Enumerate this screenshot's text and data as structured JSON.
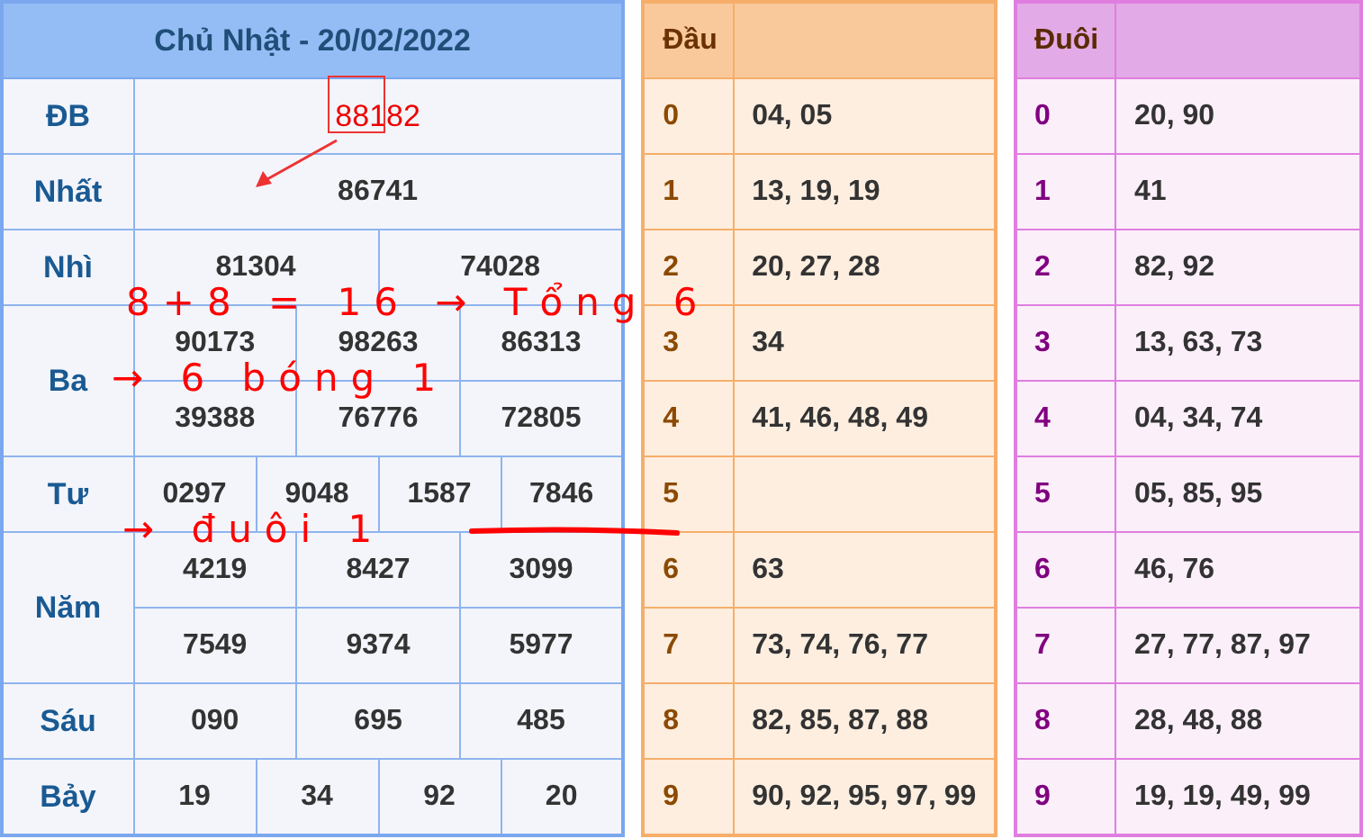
{
  "result_table": {
    "title": "Chủ Nhật - 20/02/2022",
    "prizes": [
      {
        "label": "ĐB",
        "kind": "special",
        "rows": [
          [
            "88182"
          ]
        ]
      },
      {
        "label": "Nhất",
        "kind": "normal",
        "rows": [
          [
            "86741"
          ]
        ]
      },
      {
        "label": "Nhì",
        "kind": "normal",
        "rows": [
          [
            "81304",
            "74028"
          ]
        ]
      },
      {
        "label": "Ba",
        "kind": "normal",
        "rows": [
          [
            "90173",
            "98263",
            "86313"
          ],
          [
            "39388",
            "76776",
            "72805"
          ]
        ]
      },
      {
        "label": "Tư",
        "kind": "normal",
        "rows": [
          [
            "0297",
            "9048",
            "1587",
            "7846"
          ]
        ]
      },
      {
        "label": "Năm",
        "kind": "normal",
        "rows": [
          [
            "4219",
            "8427",
            "3099"
          ],
          [
            "7549",
            "9374",
            "5977"
          ]
        ]
      },
      {
        "label": "Sáu",
        "kind": "normal",
        "rows": [
          [
            "090",
            "695",
            "485"
          ]
        ]
      },
      {
        "label": "Bảy",
        "kind": "normal",
        "rows": [
          [
            "19",
            "34",
            "92",
            "20"
          ]
        ]
      }
    ]
  },
  "head_table": {
    "title": "Đầu",
    "rows": [
      {
        "digit": "0",
        "numbers": "04, 05"
      },
      {
        "digit": "1",
        "numbers": "13, 19, 19"
      },
      {
        "digit": "2",
        "numbers": "20, 27, 28"
      },
      {
        "digit": "3",
        "numbers": "34"
      },
      {
        "digit": "4",
        "numbers": "41, 46, 48, 49"
      },
      {
        "digit": "5"
      },
      {
        "digit": "6",
        "numbers": "63"
      },
      {
        "digit": "7",
        "numbers": "73, 74, 76, 77"
      },
      {
        "digit": "8",
        "numbers": "82, 85, 87, 88"
      },
      {
        "digit": "9",
        "numbers": "90, 92, 95, 97, 99"
      }
    ]
  },
  "tail_table": {
    "title": "Đuôi",
    "rows": [
      {
        "digit": "0",
        "numbers": "20, 90"
      },
      {
        "digit": "1",
        "numbers": "41"
      },
      {
        "digit": "2",
        "numbers": "82, 92"
      },
      {
        "digit": "3",
        "numbers": "13, 63, 73"
      },
      {
        "digit": "4",
        "numbers": "04, 34, 74"
      },
      {
        "digit": "5",
        "numbers": "05, 85, 95"
      },
      {
        "digit": "6",
        "numbers": "46, 76"
      },
      {
        "digit": "7",
        "numbers": "27, 77, 87, 97"
      },
      {
        "digit": "8",
        "numbers": "28, 48, 88"
      },
      {
        "digit": "9",
        "numbers": "19, 19, 49, 99"
      }
    ]
  },
  "annotations": [
    {
      "kind": "box"
    },
    {
      "kind": "arrow"
    },
    {
      "kind": "text",
      "text": "8+8 = 16 → Tổng 6"
    },
    {
      "kind": "text",
      "text": "→ 6 bóng 1"
    },
    {
      "kind": "text",
      "text": "→ đuôi 1"
    },
    {
      "kind": "stroke"
    }
  ]
}
